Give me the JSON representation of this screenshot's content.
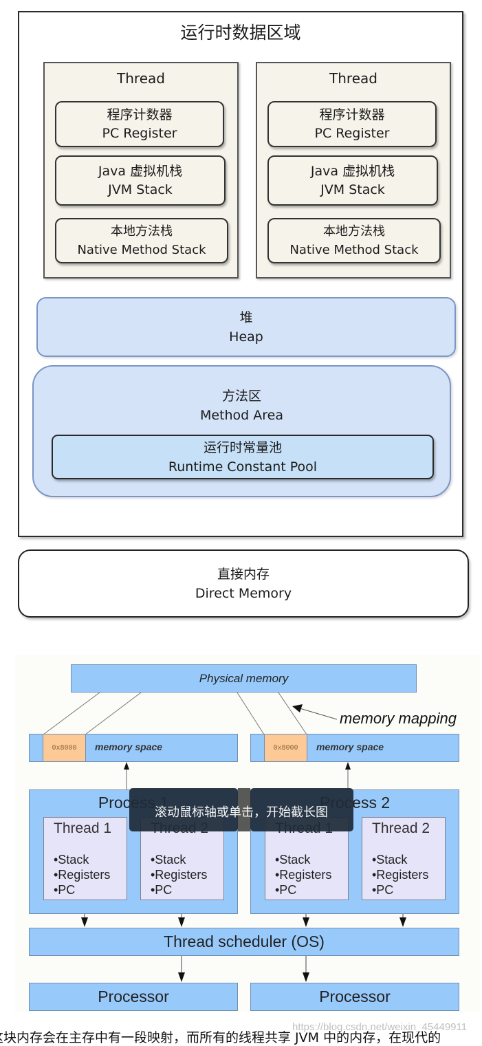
{
  "diagram1": {
    "title": "运行时数据区域",
    "threads": [
      {
        "title": "Thread",
        "pc_register": {
          "zh": "程序计数器",
          "en": "PC Register"
        },
        "jvm_stack": {
          "zh": "Java 虚拟机栈",
          "en": "JVM Stack"
        },
        "native_stack": {
          "zh": "本地方法栈",
          "en": "Native Method Stack"
        }
      },
      {
        "title": "Thread",
        "pc_register": {
          "zh": "程序计数器",
          "en": "PC Register"
        },
        "jvm_stack": {
          "zh": "Java 虚拟机栈",
          "en": "JVM Stack"
        },
        "native_stack": {
          "zh": "本地方法栈",
          "en": "Native Method Stack"
        }
      }
    ],
    "heap": {
      "zh": "堆",
      "en": "Heap"
    },
    "method_area": {
      "zh": "方法区",
      "en": "Method Area"
    },
    "constant_pool": {
      "zh": "运行时常量池",
      "en": "Runtime Constant Pool"
    },
    "direct_memory": {
      "zh": "直接内存",
      "en": "Direct Memory"
    }
  },
  "diagram2": {
    "physical_memory": "Physical memory",
    "memory_mapping": "memory mapping",
    "memory_spaces": [
      {
        "address": "0x8000",
        "label": "memory space"
      },
      {
        "address": "0x8000",
        "label": "memory space"
      }
    ],
    "processes": [
      {
        "title": "Process 1",
        "threads": [
          {
            "title": "Thread 1",
            "items": [
              "•Stack",
              "•Registers",
              "•PC"
            ]
          },
          {
            "title": "Thread 2",
            "items": [
              "•Stack",
              "•Registers",
              "•PC"
            ]
          }
        ]
      },
      {
        "title": "Process 2",
        "threads": [
          {
            "title": "Thread 1",
            "items": [
              "•Stack",
              "•Registers",
              "•PC"
            ]
          },
          {
            "title": "Thread 2",
            "items": [
              "•Stack",
              "•Registers",
              "•PC"
            ]
          }
        ]
      }
    ],
    "scheduler": "Thread scheduler (OS)",
    "processors": [
      "Processor",
      "Processor"
    ]
  },
  "overlay": {
    "tooltip": "滚动鼠标轴或单击，开始截长图"
  },
  "paragraph": "这块内存会在主存中有一段映射，而所有的线程共享 JVM 中的内存，在现代的",
  "watermark": "https://blog.csdn.net/weixin_45449911"
}
